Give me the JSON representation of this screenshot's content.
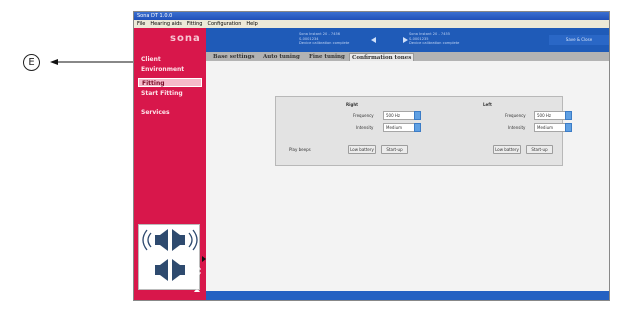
{
  "callout": {
    "letter": "E"
  },
  "window": {
    "title": "Sona DT 1.0.0",
    "menu": [
      "File",
      "Hearing aids",
      "Fitting",
      "Configuration",
      "Help"
    ]
  },
  "brand": "sona",
  "sidebar": {
    "items": [
      {
        "label": "Client"
      },
      {
        "label": "Environment"
      },
      {
        "label": "Fitting"
      },
      {
        "label": "Start Fitting"
      },
      {
        "label": "Services"
      }
    ]
  },
  "header": {
    "left_device": [
      "Sona Instant 20 - 7456",
      "S-0001234",
      "Device calibration complete"
    ],
    "right_device": [
      "Sona Instant 20 - 7455",
      "S-0001235",
      "Device calibration complete"
    ],
    "right_button": "Save & Close"
  },
  "tabs": [
    {
      "label": "Base settings"
    },
    {
      "label": "Auto tuning"
    },
    {
      "label": "Fine tuning"
    },
    {
      "label": "Confirmation tones"
    }
  ],
  "panel": {
    "right": {
      "heading": "Right",
      "frequency_label": "Frequency",
      "frequency_value": "500 Hz",
      "intensity_label": "Intensity",
      "intensity_value": "Medium"
    },
    "left": {
      "heading": "Left",
      "frequency_label": "Frequency",
      "frequency_value": "500 Hz",
      "intensity_label": "Intensity",
      "intensity_value": "Medium"
    },
    "play_beeps_label": "Play beeps",
    "low_battery": "Low battery",
    "start_up": "Start-up"
  },
  "colors": {
    "sidebar": "#d8174b",
    "header": "#1f5bb8",
    "accent": "#5fa0e3"
  }
}
